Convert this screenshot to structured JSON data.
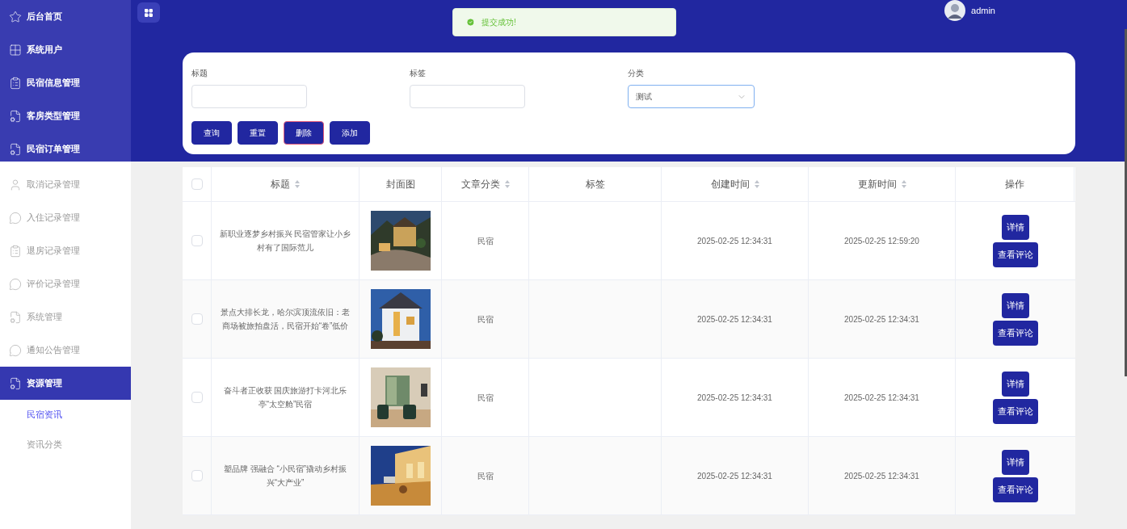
{
  "header": {
    "user": "admin"
  },
  "toast": {
    "kind": "success",
    "text": "提交成功!"
  },
  "sidebar": {
    "top_items": [
      {
        "label": "后台首页"
      },
      {
        "label": "系统用户"
      },
      {
        "label": "民宿信息管理"
      },
      {
        "label": "客房类型管理"
      },
      {
        "label": "民宿订单管理"
      }
    ],
    "items": [
      {
        "label": "取消记录管理",
        "selected": false
      },
      {
        "label": "入住记录管理",
        "selected": false
      },
      {
        "label": "退房记录管理",
        "selected": false
      },
      {
        "label": "评价记录管理",
        "selected": false
      },
      {
        "label": "系统管理",
        "selected": false
      },
      {
        "label": "通知公告管理",
        "selected": false
      },
      {
        "label": "资源管理",
        "selected": true,
        "children": [
          {
            "label": "民宿资讯",
            "selected": true
          },
          {
            "label": "资讯分类",
            "selected": false
          }
        ]
      }
    ]
  },
  "search": {
    "fields": [
      {
        "kind": "text",
        "label": "标题"
      },
      {
        "kind": "text",
        "label": "标签"
      },
      {
        "kind": "select",
        "label": "分类",
        "value": "测试",
        "focused": true
      }
    ],
    "buttons": [
      {
        "label": "查询",
        "focused": false
      },
      {
        "label": "重置",
        "focused": false
      },
      {
        "label": "删除",
        "focused": true
      },
      {
        "label": "添加",
        "focused": false
      }
    ]
  },
  "table": {
    "all_checked": false,
    "columns": [
      {
        "label": "标题",
        "sortable": true
      },
      {
        "label": "封面图",
        "sortable": false
      },
      {
        "label": "文章分类",
        "sortable": true
      },
      {
        "label": "标签",
        "sortable": false
      },
      {
        "label": "创建时间",
        "sortable": true
      },
      {
        "label": "更新时间",
        "sortable": true
      },
      {
        "label": "操作",
        "sortable": false
      }
    ],
    "rows": [
      {
        "checked": false,
        "title": "新职业逐梦乡村振兴 民宿管家让小乡村有了国际范儿",
        "category": "民宿",
        "created": "2025-02-25 12:34:31",
        "updated": "2025-02-25 12:59:20",
        "actions": [
          "详情",
          "查看评论"
        ]
      },
      {
        "checked": false,
        "title": "景点大排长龙，哈尔滨顶流依旧：老商场被旅拍盘活，民宿开始“卷”低价",
        "category": "民宿",
        "created": "2025-02-25 12:34:31",
        "updated": "2025-02-25 12:34:31",
        "actions": [
          "详情",
          "查看评论"
        ]
      },
      {
        "checked": false,
        "title": "奋斗者正收获 国庆旅游打卡河北乐亭“太空舱”民宿",
        "category": "民宿",
        "created": "2025-02-25 12:34:31",
        "updated": "2025-02-25 12:34:31",
        "actions": [
          "详情",
          "查看评论"
        ]
      },
      {
        "checked": false,
        "title": "塑品牌 强融合 “小民宿”撬动乡村振兴“大产业”",
        "category": "民宿",
        "created": "2025-02-25 12:34:31",
        "updated": "2025-02-25 12:34:31",
        "actions": [
          "详情",
          "查看评论"
        ]
      }
    ]
  }
}
